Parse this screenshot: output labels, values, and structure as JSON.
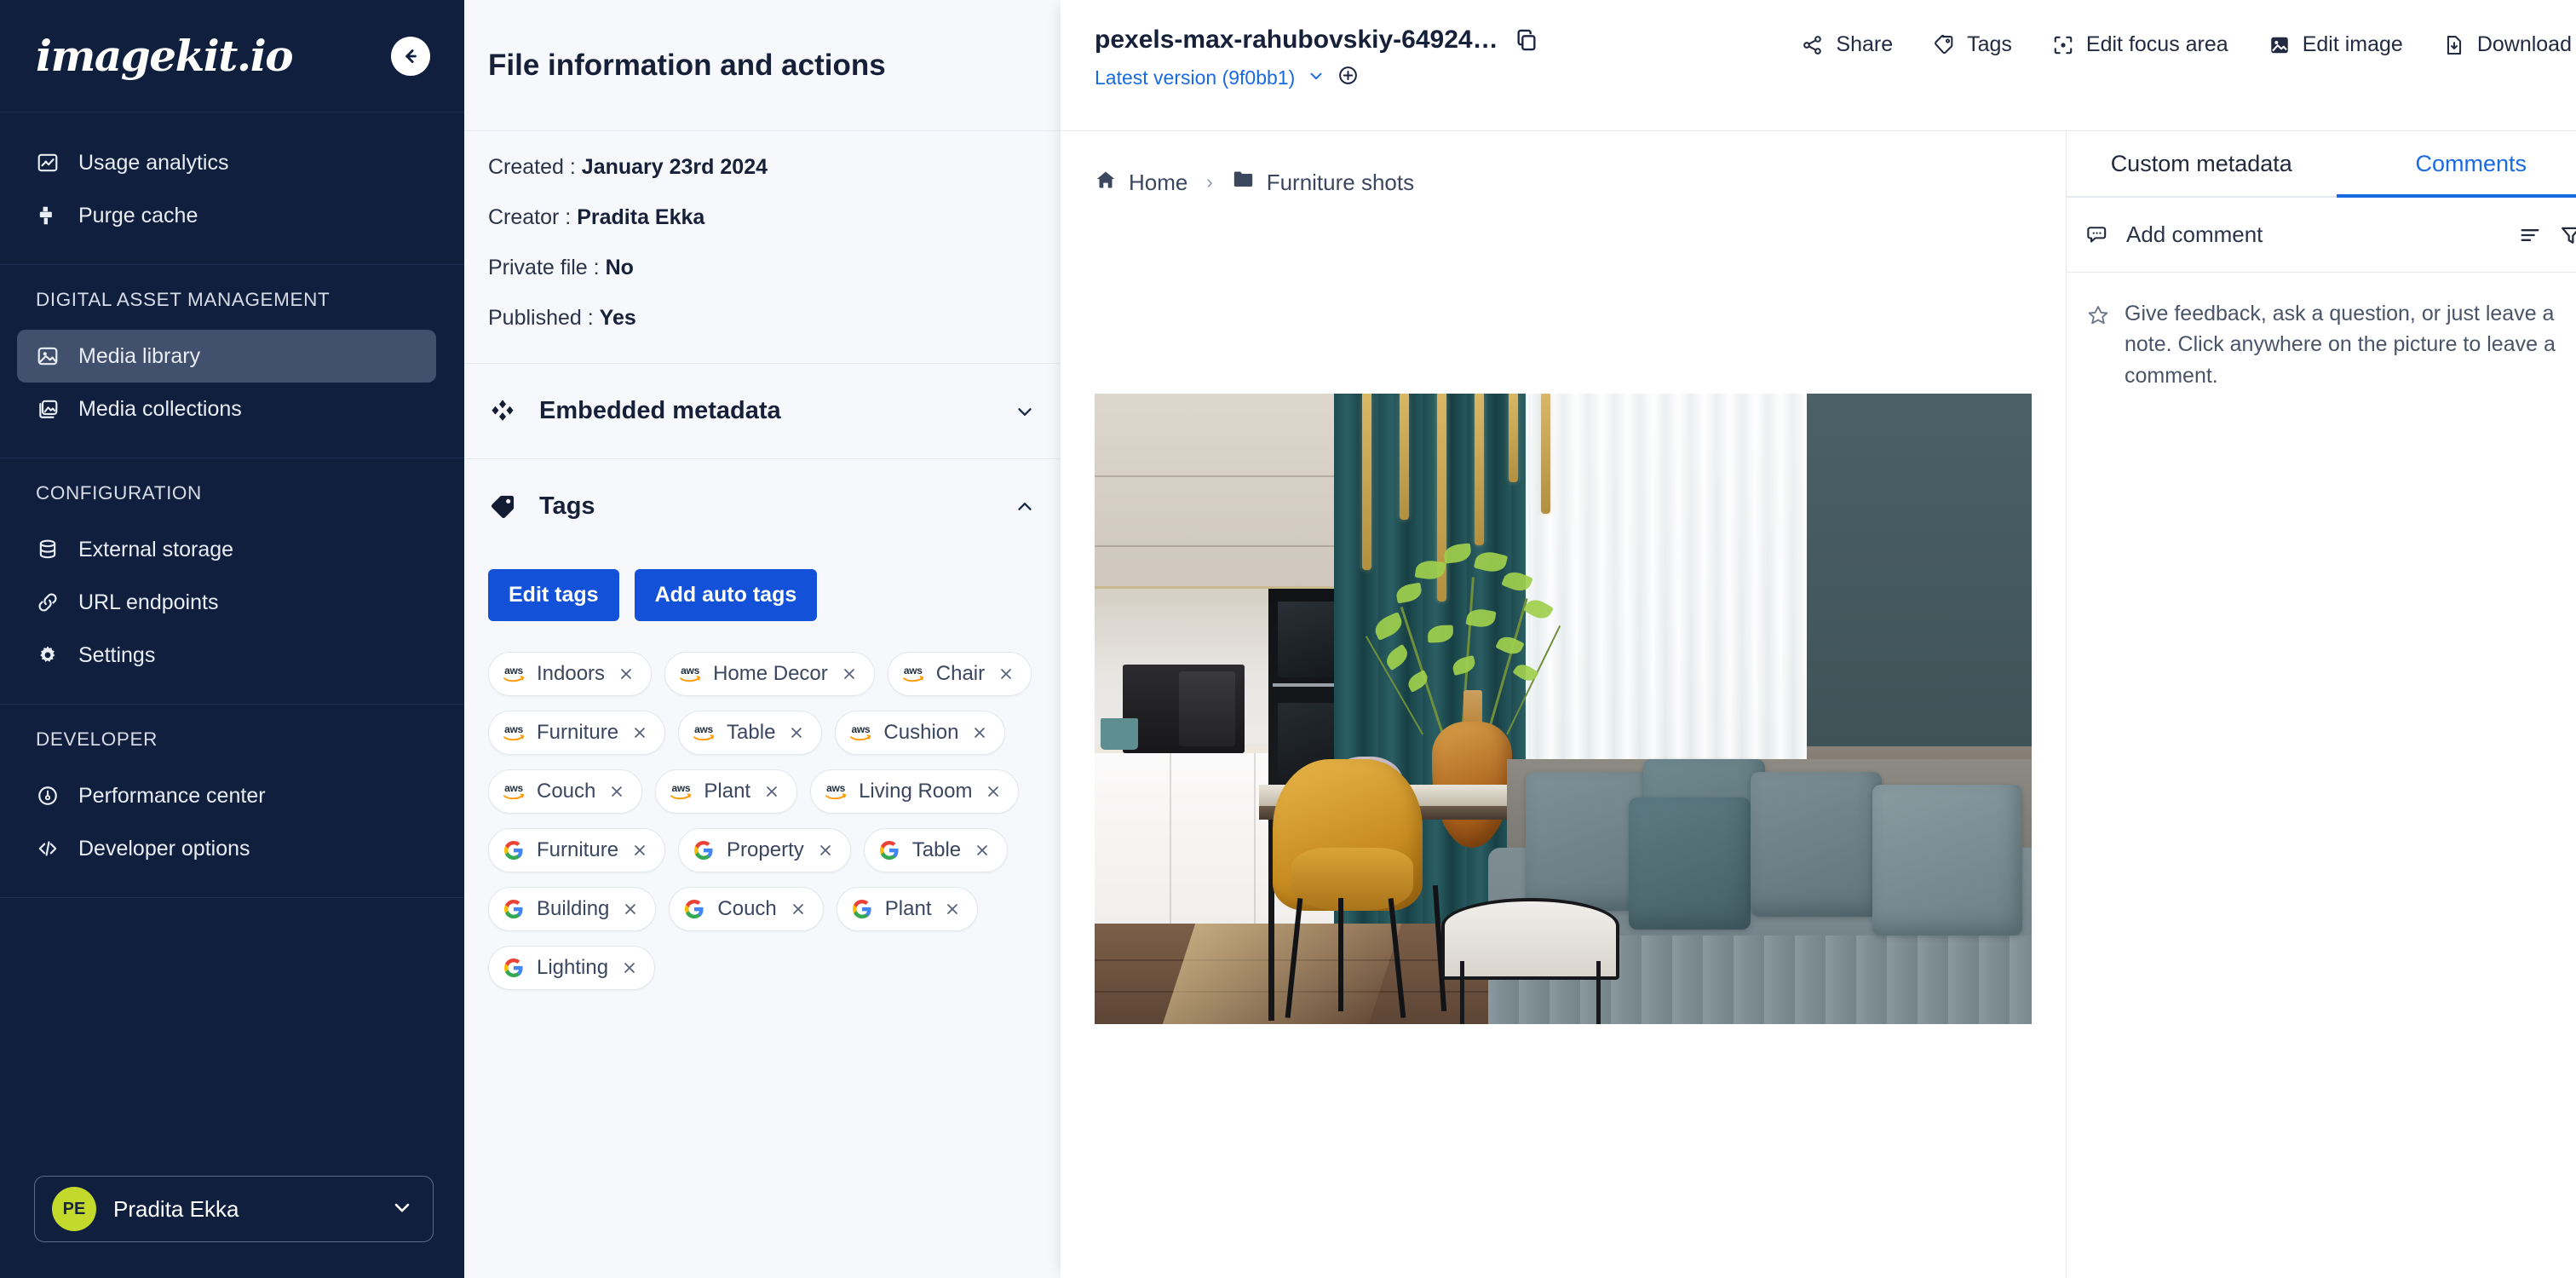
{
  "sidebar": {
    "logo_text": "imagekit.io",
    "collapse_icon": "arrow-left-circle-icon",
    "groups": [
      {
        "label": "",
        "items": [
          {
            "label": "Usage analytics",
            "icon": "chart-icon",
            "active": false
          },
          {
            "label": "Purge cache",
            "icon": "purge-icon",
            "active": false
          }
        ]
      },
      {
        "label": "DIGITAL ASSET MANAGEMENT",
        "items": [
          {
            "label": "Media library",
            "icon": "image-icon",
            "active": true
          },
          {
            "label": "Media collections",
            "icon": "images-icon",
            "active": false
          }
        ]
      },
      {
        "label": "CONFIGURATION",
        "items": [
          {
            "label": "External storage",
            "icon": "database-icon",
            "active": false
          },
          {
            "label": "URL endpoints",
            "icon": "link-icon",
            "active": false
          },
          {
            "label": "Settings",
            "icon": "gear-icon",
            "active": false
          }
        ]
      },
      {
        "label": "DEVELOPER",
        "items": [
          {
            "label": "Performance center",
            "icon": "speedometer-icon",
            "active": false
          },
          {
            "label": "Developer options",
            "icon": "code-icon",
            "active": false
          }
        ]
      }
    ],
    "user": {
      "initials": "PE",
      "name": "Pradita Ekka",
      "chevron_icon": "chevron-down-icon",
      "avatar_color": "#c3d92b"
    }
  },
  "info_panel": {
    "title": "File information and actions",
    "fields": [
      {
        "label": "Created :",
        "value": "January 23rd 2024"
      },
      {
        "label": "Creator :",
        "value": "Pradita Ekka"
      },
      {
        "label": "Private file :",
        "value": "No"
      },
      {
        "label": "Published :",
        "value": "Yes"
      }
    ],
    "embedded_metadata": {
      "title": "Embedded metadata",
      "icon": "diamond-cluster-icon",
      "chevron": "chevron-down-icon",
      "expanded": false
    },
    "tags_section": {
      "title": "Tags",
      "icon": "tag-icon",
      "chevron": "chevron-up-icon",
      "expanded": true,
      "edit_tags_label": "Edit tags",
      "add_auto_tags_label": "Add auto tags",
      "tags": [
        {
          "label": "Indoors",
          "source": "aws"
        },
        {
          "label": "Home Decor",
          "source": "aws"
        },
        {
          "label": "Chair",
          "source": "aws"
        },
        {
          "label": "Furniture",
          "source": "aws"
        },
        {
          "label": "Table",
          "source": "aws"
        },
        {
          "label": "Cushion",
          "source": "aws"
        },
        {
          "label": "Couch",
          "source": "aws"
        },
        {
          "label": "Plant",
          "source": "aws"
        },
        {
          "label": "Living Room",
          "source": "aws"
        },
        {
          "label": "Furniture",
          "source": "google"
        },
        {
          "label": "Property",
          "source": "google"
        },
        {
          "label": "Table",
          "source": "google"
        },
        {
          "label": "Building",
          "source": "google"
        },
        {
          "label": "Couch",
          "source": "google"
        },
        {
          "label": "Plant",
          "source": "google"
        },
        {
          "label": "Lighting",
          "source": "google"
        }
      ]
    }
  },
  "center": {
    "file_name": "pexels-max-rahubovskiy-64924…",
    "copy_icon": "copy-icon",
    "version_label": "Latest version (9f0bb1)",
    "version_chevron": "chevron-down-icon",
    "version_add_icon": "plus-circle-icon",
    "actions": [
      {
        "label": "Share",
        "icon": "share-icon"
      },
      {
        "label": "Tags",
        "icon": "tag-icon"
      },
      {
        "label": "Edit focus area",
        "icon": "focus-icon"
      },
      {
        "label": "Edit image",
        "icon": "image-edit-icon"
      },
      {
        "label": "Download",
        "icon": "download-icon"
      }
    ],
    "breadcrumb": [
      {
        "label": "Home",
        "icon": "home-icon"
      },
      {
        "label": "Furniture shots",
        "icon": "folder-icon"
      }
    ],
    "breadcrumb_separator": "›",
    "preview_alt": "living room interior with teal curtains, yellow chair, dining table and grey sofa"
  },
  "rightbar": {
    "tabs": [
      {
        "label": "Custom metadata",
        "active": false
      },
      {
        "label": "Comments",
        "active": true
      }
    ],
    "add_comment_label": "Add comment",
    "add_comment_icon": "comment-icon",
    "sort_icon": "sort-icon",
    "filter_icon": "filter-icon",
    "hint_icon": "pin-icon",
    "hint_text": "Give feedback, ask a question, or just leave a note. Click anywhere on the picture to leave a comment."
  },
  "colors": {
    "sidebar_bg": "#0f1f3d",
    "accent_blue": "#1352d8",
    "link_blue": "#1a6ae0",
    "panel_bg": "#f7f8fb",
    "avatar_green": "#c3d92b",
    "aws_orange": "#ff9900",
    "google_blue": "#4285f4",
    "google_red": "#ea4335",
    "google_yellow": "#fbbc05",
    "google_green": "#34a853"
  }
}
